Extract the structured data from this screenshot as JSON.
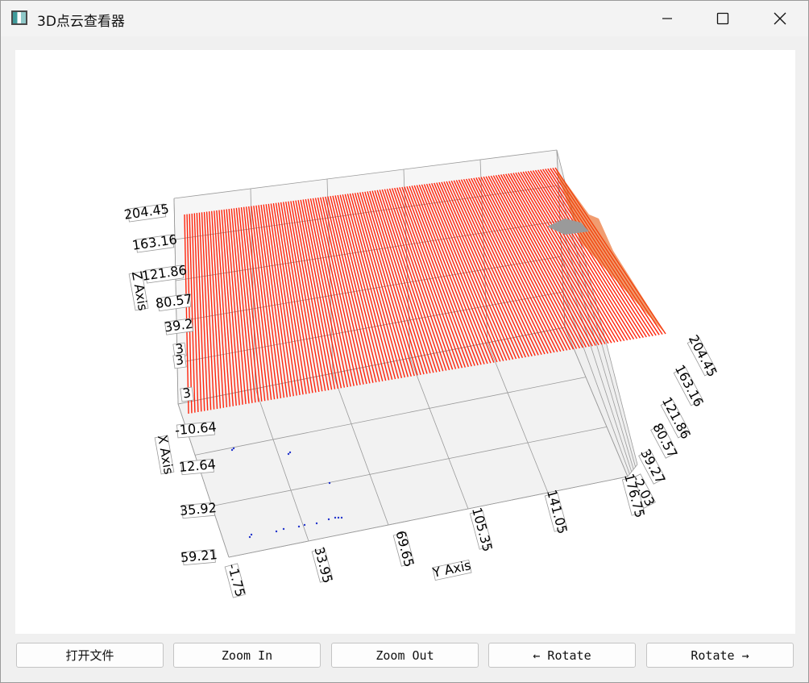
{
  "window": {
    "title": "3D点云查看器"
  },
  "toolbar": {
    "open_file_label": "打开文件",
    "zoom_in_label": "Zoom In",
    "zoom_out_label": "Zoom Out",
    "rotate_left_label": "← Rotate",
    "rotate_right_label": "Rotate →"
  },
  "chart_data": {
    "type": "scatter",
    "subtype": "3d-point-cloud",
    "axes": {
      "x_label": "X Axis",
      "y_label": "Y Axis",
      "z_label": "Z Axis",
      "x_ticks": [
        "-10.64",
        "12.64",
        "35.92",
        "59.21"
      ],
      "y_ticks": [
        "-1.75",
        "33.95",
        "69.65",
        "105.35",
        "141.05",
        "176.75"
      ],
      "z_ticks_left": [
        "204.45",
        "163.16",
        "121.86",
        "80.57",
        "39.2",
        "3",
        "3",
        "3"
      ],
      "z_ticks_right": [
        "204.45",
        "163.16",
        "121.86",
        "80.57",
        "39.27",
        "-2.03"
      ]
    },
    "series": [
      {
        "color": "#ff1a00",
        "description_level": "dense surface at top of z range"
      },
      {
        "color": "#2233cc",
        "description_level": "sparse points near floor"
      }
    ],
    "colors": {
      "surface": "#ff1a00",
      "surface_edge": "#e85a10",
      "floor_points": "#2233cc",
      "grid": "#9a9a9a",
      "pane": "#f2f2f2"
    },
    "grid": true
  }
}
